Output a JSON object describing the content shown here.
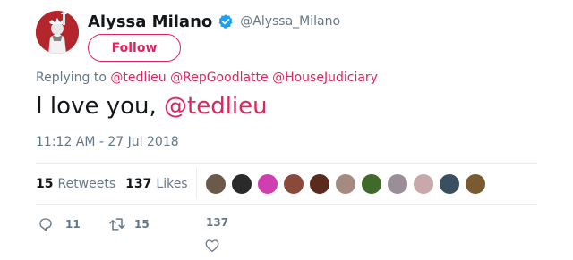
{
  "author": {
    "display_name": "Alyssa Milano",
    "handle": "@Alyssa_Milano",
    "verified": true,
    "avatar_icon": "statue-of-liberty-avatar"
  },
  "follow_label": "Follow",
  "replying": {
    "prefix": "Replying to",
    "mentions": [
      "@tedlieu",
      "@RepGoodlatte",
      "@HouseJudiciary"
    ]
  },
  "tweet": {
    "text": "I love you, ",
    "mention": "@tedlieu"
  },
  "timestamp": "11:12 AM - 27 Jul 2018",
  "stats": {
    "retweets_count": "15",
    "retweets_label": "Retweets",
    "likes_count": "137",
    "likes_label": "Likes"
  },
  "likers": [
    {
      "color": "#6b5a4a"
    },
    {
      "color": "#2a2a2a"
    },
    {
      "color": "#cf3fb0"
    },
    {
      "color": "#8a4a3a"
    },
    {
      "color": "#5a2a1e"
    },
    {
      "color": "#a48a80"
    },
    {
      "color": "#3f6a2a"
    },
    {
      "color": "#9a8e98"
    },
    {
      "color": "#c8a8a8"
    },
    {
      "color": "#3a5060"
    },
    {
      "color": "#7a5a30"
    }
  ],
  "actions": {
    "reply_count": "11",
    "retweet_count": "15",
    "like_count": "137"
  },
  "colors": {
    "accent": "#e0245e",
    "muted": "#657786",
    "verified": "#1da1f2"
  }
}
